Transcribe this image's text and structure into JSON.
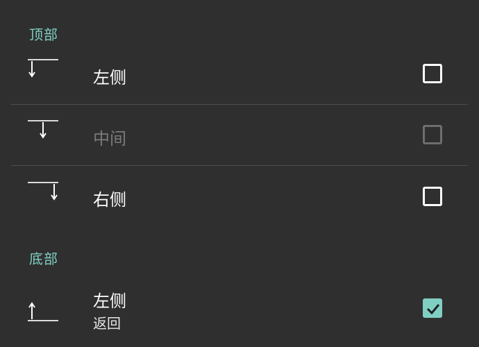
{
  "sections": {
    "top": {
      "header": "顶部",
      "rows": [
        {
          "label": "左侧",
          "checked": false,
          "enabled": true,
          "icon": "align-top-left-icon"
        },
        {
          "label": "中间",
          "checked": false,
          "enabled": false,
          "icon": "align-top-center-icon"
        },
        {
          "label": "右侧",
          "checked": false,
          "enabled": true,
          "icon": "align-top-right-icon"
        }
      ]
    },
    "bottom": {
      "header": "底部",
      "rows": [
        {
          "label": "左侧",
          "sublabel": "返回",
          "checked": true,
          "enabled": true,
          "icon": "align-bottom-left-icon"
        }
      ]
    }
  },
  "colors": {
    "background": "#2f2f2f",
    "accent": "#7fcfc3",
    "divider": "#4d4d4d",
    "text": "#ffffff",
    "disabled_text": "#7a7a7a"
  }
}
